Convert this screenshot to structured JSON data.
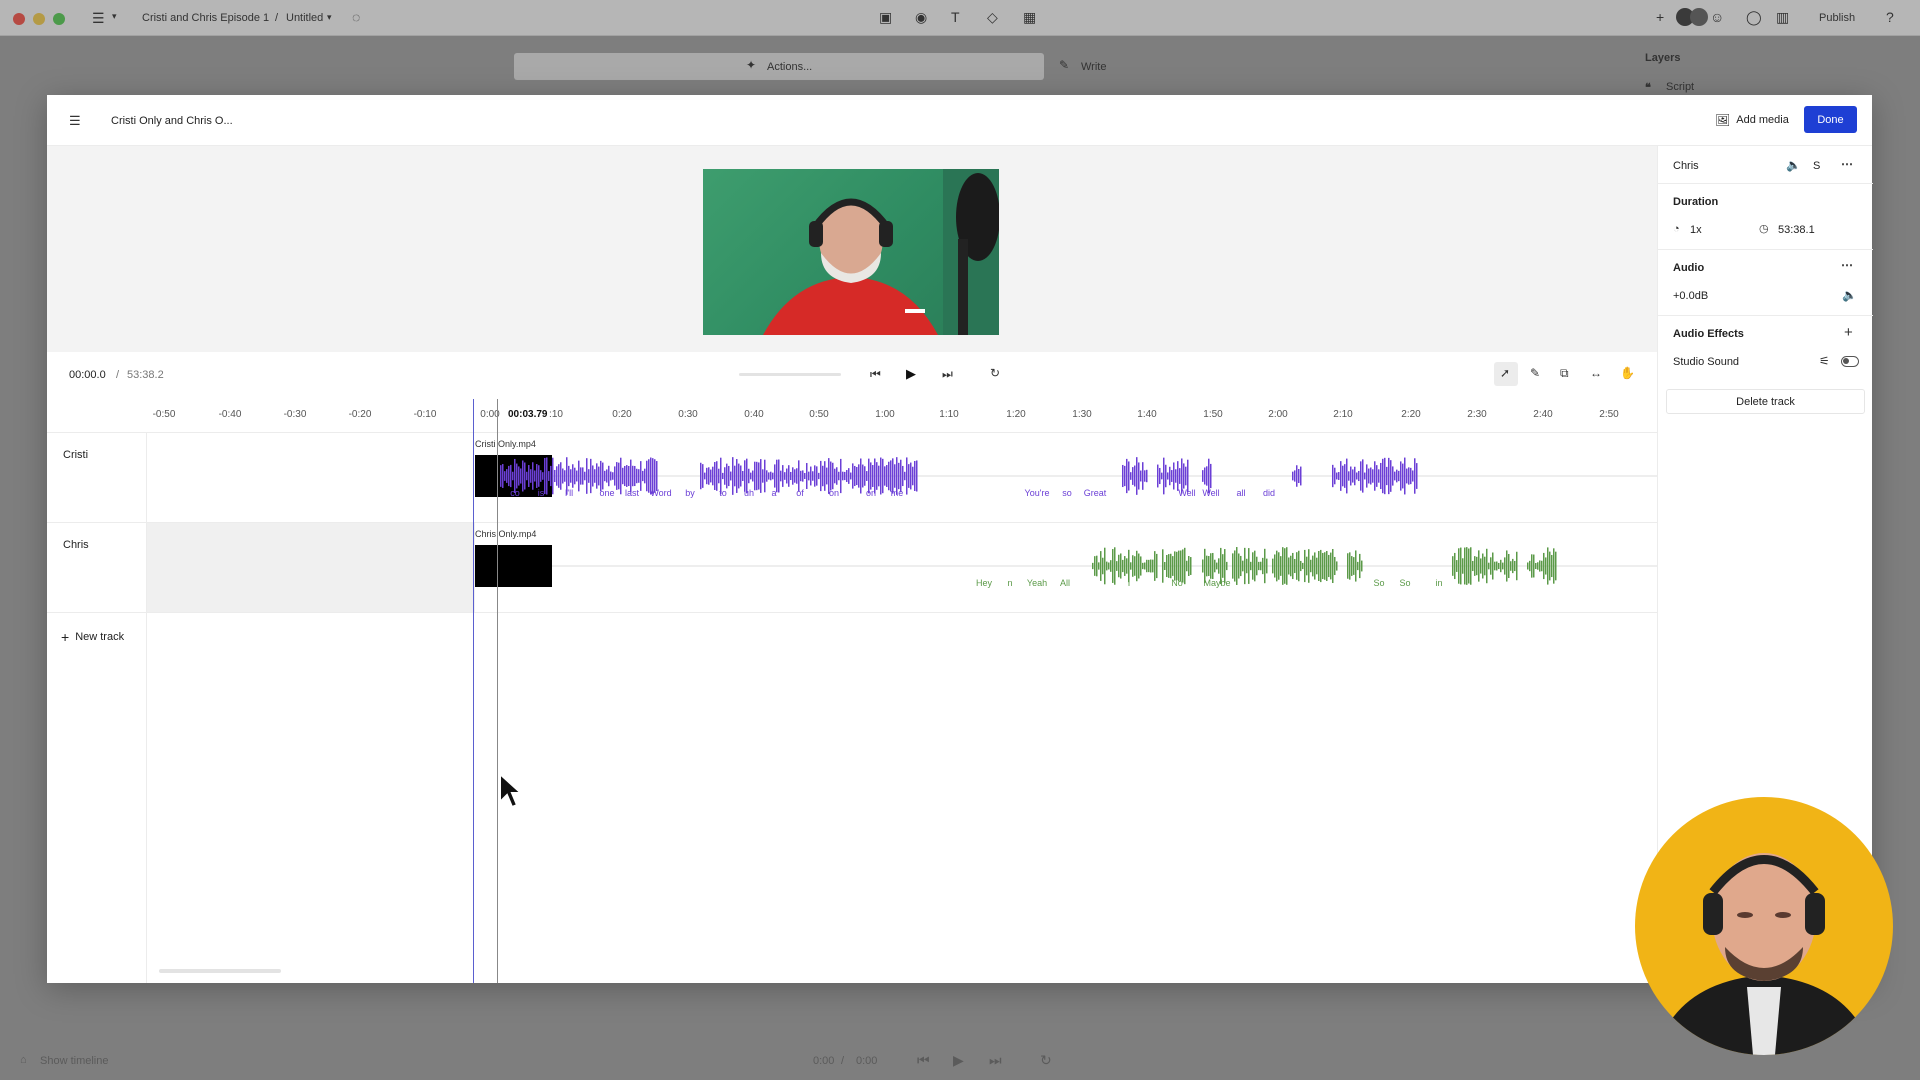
{
  "app": {
    "breadcrumb_project": "Cristi and Chris Episode 1",
    "breadcrumb_sep": "/",
    "breadcrumb_doc": "Untitled",
    "publish_label": "Publish",
    "actions_label": "Actions...",
    "write_label": "Write",
    "layers_title": "Layers",
    "layers_item": "Script",
    "show_timeline_label": "Show timeline",
    "bottom_time_current": "0:00",
    "bottom_time_sep": "/",
    "bottom_time_total": "0:00"
  },
  "modal": {
    "title": "Cristi Only and Chris O...",
    "add_media_label": "Add media",
    "done_label": "Done"
  },
  "transport": {
    "current_time": "00:00.0",
    "time_sep": "/",
    "total_time": "53:38.2"
  },
  "ruler": {
    "ticks": [
      "-0:50",
      "-0:40",
      "-0:30",
      "-0:20",
      "-0:10",
      "0:00",
      ":10",
      "0:20",
      "0:30",
      "0:40",
      "0:50",
      "1:00",
      "1:10",
      "1:20",
      "1:30",
      "1:40",
      "1:50",
      "2:00",
      "2:10",
      "2:20",
      "2:30",
      "2:40",
      "2:50"
    ],
    "playhead_time": "00:03.79"
  },
  "tracks": [
    {
      "name": "Cristi",
      "clip_name": "Cristi Only.mp4",
      "words": [
        "co",
        "is",
        "I'll",
        "one",
        "last",
        "Word",
        "by",
        "to",
        "uh",
        "a",
        "of",
        "on",
        "on",
        "me",
        "You're",
        "so",
        "Great",
        "Well",
        "Well",
        "all",
        "did"
      ],
      "color": "#6b3fd6"
    },
    {
      "name": "Chris",
      "clip_name": "Chris Only.mp4",
      "words": [
        "Hey",
        "n",
        "Yeah",
        "All",
        "I",
        "No",
        "Maybe",
        "So",
        "So",
        "in"
      ],
      "color": "#5b9a48"
    }
  ],
  "new_track_label": "New track",
  "side_panel": {
    "track_name": "Chris",
    "solo_label": "S",
    "duration_title": "Duration",
    "speed": "1x",
    "duration_value": "53:38.1",
    "audio_title": "Audio",
    "gain": "+0.0dB",
    "effects_title": "Audio Effects",
    "effect_name": "Studio Sound",
    "delete_label": "Delete track"
  },
  "icons": {
    "menu": "menu-icon",
    "add_media": "image-icon",
    "volume": "speaker-icon",
    "more": "more-icon",
    "speed": "speed-icon",
    "clock": "clock-icon",
    "plus": "plus-icon",
    "sliders": "sliders-icon",
    "toggle": "toggle-icon"
  },
  "colors": {
    "accent": "#1e3fd4",
    "cristi_wave": "#6b3fd6",
    "chris_wave": "#5b9a48",
    "webcam_bg": "#f1b416"
  }
}
